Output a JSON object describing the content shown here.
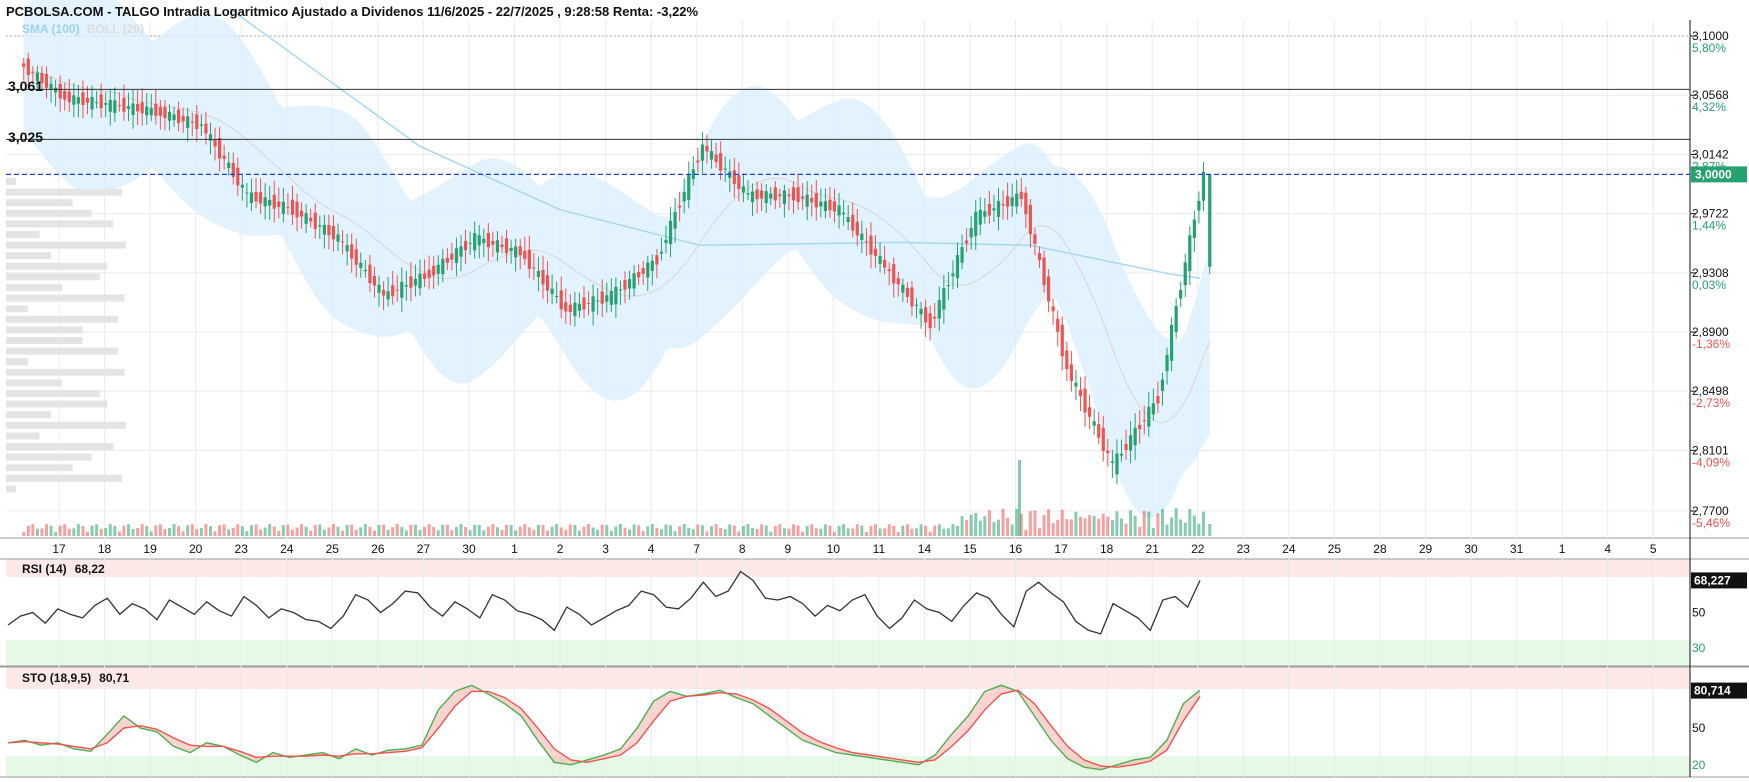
{
  "header": {
    "title": "PCBOLSA.COM - TALGO Intradia Logaritmico Ajustado a Dividenos 11/6/2025 - 22/7/2025 , 9:28:58 Renta: -3,22%"
  },
  "legend": {
    "sma_label": "SMA (100)",
    "boll_label": "BOLL (20)"
  },
  "colors": {
    "up": "#26a270",
    "down": "#ef5350",
    "sma": "#a8d8f0",
    "band_fill": "#dcefff",
    "level_line": "#333333",
    "last_price_line": "#1f3fd8",
    "last_price_tag": "#26a270",
    "rsi_line": "#333333",
    "sto_fast": "#4caf50",
    "sto_slow": "#ef5350",
    "overbought_zone": "#fde8e8",
    "oversold_zone": "#e6f9e6",
    "pct_up": "#26a270",
    "pct_down": "#ef5350"
  },
  "chart_data": [
    {
      "type": "candlestick",
      "title": "TALGO Intradia Logaritmico Ajustado a Dividenos 11/6/2025 - 22/7/2025",
      "scale": "log",
      "ylim": [
        2.76,
        3.11
      ],
      "y_ticks": [
        {
          "value": "3,1000",
          "pct": "5,80%"
        },
        {
          "value": "3,0568",
          "pct": "4,32%"
        },
        {
          "value": "3,0142",
          "pct": "2,87%"
        },
        {
          "value": "2,9722",
          "pct": "1,44%"
        },
        {
          "value": "2,9308",
          "pct": "0,03%"
        },
        {
          "value": "2,8900",
          "pct": "-1,36%"
        },
        {
          "value": "2,8498",
          "pct": "-2,73%"
        },
        {
          "value": "2,8101",
          "pct": "-4,09%"
        },
        {
          "value": "2,7700",
          "pct": "-5,46%"
        }
      ],
      "x_ticks": [
        "17",
        "18",
        "19",
        "20",
        "23",
        "24",
        "25",
        "26",
        "27",
        "30",
        "1",
        "2",
        "3",
        "4",
        "7",
        "8",
        "9",
        "10",
        "11",
        "14",
        "15",
        "16",
        "17",
        "18",
        "21",
        "22",
        "23",
        "24",
        "25",
        "28",
        "29",
        "30",
        "31",
        "1",
        "4",
        "5"
      ],
      "horizontal_levels": [
        {
          "label": "3,061",
          "value": 3.061
        },
        {
          "label": "3,025",
          "value": 3.025
        }
      ],
      "last_price": {
        "label": "3,0000",
        "value": 3.0
      },
      "series_close_by_session": [
        {
          "day": "16",
          "close": 3.08
        },
        {
          "day": "17",
          "close": 3.055
        },
        {
          "day": "18",
          "close": 3.05
        },
        {
          "day": "19",
          "close": 3.045
        },
        {
          "day": "20",
          "close": 3.035
        },
        {
          "day": "23",
          "close": 2.985
        },
        {
          "day": "24",
          "close": 2.975
        },
        {
          "day": "25",
          "close": 2.955
        },
        {
          "day": "26",
          "close": 2.915
        },
        {
          "day": "27",
          "close": 2.93
        },
        {
          "day": "30",
          "close": 2.955
        },
        {
          "day": "1",
          "close": 2.945
        },
        {
          "day": "2",
          "close": 2.905
        },
        {
          "day": "3",
          "close": 2.915
        },
        {
          "day": "4",
          "close": 2.94
        },
        {
          "day": "7",
          "close": 3.02
        },
        {
          "day": "8",
          "close": 2.985
        },
        {
          "day": "9",
          "close": 2.985
        },
        {
          "day": "10",
          "close": 2.975
        },
        {
          "day": "11",
          "close": 2.935
        },
        {
          "day": "14",
          "close": 2.895
        },
        {
          "day": "15",
          "close": 2.97
        },
        {
          "day": "16",
          "close": 2.985
        },
        {
          "day": "17",
          "close": 2.865
        },
        {
          "day": "18",
          "close": 2.8
        },
        {
          "day": "21",
          "close": 2.845
        },
        {
          "day": "22",
          "close": 3.0
        }
      ],
      "indicators": [
        "SMA (100)",
        "BOLL (20)"
      ],
      "volume_profile": true,
      "volume_bars": true
    },
    {
      "type": "line",
      "title": "RSI (14)",
      "current_value": "68,22",
      "tag_value": "68,227",
      "y_ticks": [
        "50",
        "30"
      ],
      "zones": {
        "overbought": 70,
        "oversold": 30
      },
      "series": [
        {
          "values": [
            43,
            48,
            50,
            44,
            52,
            49,
            47,
            54,
            58,
            49,
            55,
            52,
            46,
            57,
            53,
            49,
            56,
            51,
            48,
            59,
            54,
            47,
            52,
            50,
            46,
            45,
            41,
            48,
            60,
            57,
            50,
            55,
            62,
            61,
            53,
            48,
            56,
            52,
            47,
            60,
            57,
            51,
            49,
            46,
            40,
            53,
            49,
            43,
            47,
            51,
            54,
            62,
            60,
            53,
            52,
            58,
            67,
            59,
            62,
            73,
            68,
            58,
            57,
            59,
            55,
            48,
            54,
            51,
            57,
            60,
            48,
            41,
            47,
            57,
            52,
            50,
            45,
            54,
            61,
            58,
            49,
            42,
            62,
            67,
            61,
            56,
            45,
            40,
            38,
            55,
            51,
            47,
            40,
            57,
            59,
            53,
            68
          ]
        }
      ]
    },
    {
      "type": "line",
      "title": "STO (18,9,5)",
      "current_value": "80,71",
      "tag_value": "80,714",
      "y_ticks": [
        "50",
        "20"
      ],
      "zones": {
        "overbought": 80,
        "oversold": 20
      },
      "series": [
        {
          "name": "fast",
          "values": [
            38,
            40,
            36,
            38,
            33,
            31,
            45,
            60,
            50,
            47,
            35,
            30,
            38,
            35,
            28,
            22,
            30,
            26,
            28,
            30,
            25,
            33,
            28,
            32,
            33,
            36,
            65,
            80,
            85,
            78,
            70,
            60,
            40,
            22,
            20,
            24,
            28,
            33,
            50,
            72,
            80,
            76,
            78,
            81,
            75,
            70,
            60,
            50,
            40,
            35,
            30,
            28,
            26,
            24,
            22,
            20,
            28,
            45,
            60,
            80,
            85,
            80,
            60,
            40,
            25,
            18,
            16,
            20,
            24,
            26,
            40,
            70,
            81
          ]
        },
        {
          "name": "slow",
          "values": [
            38,
            39,
            38,
            37,
            35,
            33,
            38,
            50,
            52,
            49,
            42,
            36,
            35,
            35,
            31,
            26,
            27,
            27,
            27,
            28,
            27,
            29,
            29,
            30,
            31,
            34,
            50,
            68,
            80,
            80,
            75,
            66,
            50,
            33,
            24,
            22,
            25,
            28,
            38,
            56,
            72,
            76,
            77,
            79,
            78,
            73,
            66,
            56,
            46,
            39,
            34,
            30,
            28,
            26,
            24,
            22,
            24,
            35,
            48,
            65,
            78,
            81,
            70,
            52,
            35,
            24,
            19,
            18,
            20,
            23,
            32,
            56,
            76
          ]
        }
      ]
    }
  ]
}
